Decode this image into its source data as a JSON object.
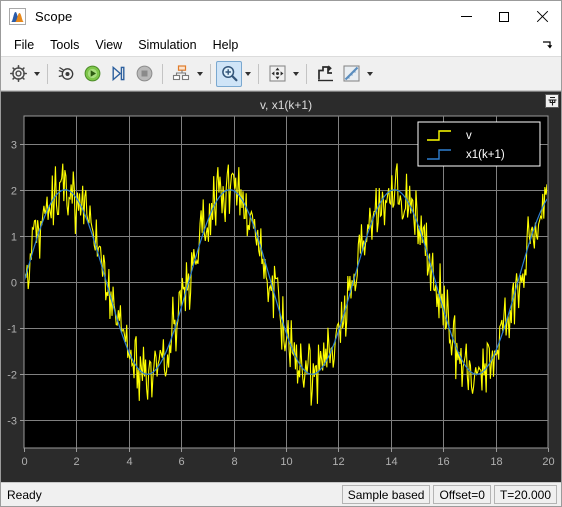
{
  "window": {
    "title": "Scope",
    "icon": "scope-app-icon",
    "controls": {
      "minimize": "minimize-icon",
      "maximize": "maximize-icon",
      "close": "close-icon"
    }
  },
  "menubar": {
    "items": [
      {
        "label": "File"
      },
      {
        "label": "Tools"
      },
      {
        "label": "View"
      },
      {
        "label": "Simulation"
      },
      {
        "label": "Help"
      }
    ],
    "expand_icon": "↘"
  },
  "toolbar": {
    "buttons": [
      {
        "name": "configuration-properties-icon",
        "tooltip": "Configuration Properties",
        "has_dropdown": true,
        "active": false
      },
      {
        "name": "simulink-link-icon",
        "tooltip": "Simulink Link",
        "has_dropdown": false,
        "active": false
      },
      {
        "name": "run-icon",
        "tooltip": "Run",
        "has_dropdown": false,
        "active": false
      },
      {
        "name": "step-forward-icon",
        "tooltip": "Step Forward",
        "has_dropdown": false,
        "active": false
      },
      {
        "name": "stop-icon",
        "tooltip": "Stop",
        "has_dropdown": false,
        "active": false
      },
      {
        "name": "layout-icon",
        "tooltip": "Layout",
        "has_dropdown": true,
        "active": false
      },
      {
        "name": "zoom-in-icon",
        "tooltip": "Zoom In",
        "has_dropdown": true,
        "active": true
      },
      {
        "name": "pan-icon",
        "tooltip": "Pan",
        "has_dropdown": true,
        "active": false
      },
      {
        "name": "autoscale-icon",
        "tooltip": "Scale Axes Limits",
        "has_dropdown": false,
        "active": false
      },
      {
        "name": "cursor-measurements-icon",
        "tooltip": "Cursor Measurements",
        "has_dropdown": true,
        "active": false
      }
    ]
  },
  "plot": {
    "title": "v, x1(k+1)",
    "pin_icon": "pin-icon",
    "background": "#000000",
    "panel_background": "#2b2b2b",
    "grid_color": "#808080",
    "axis_text_color": "#b0b0b0",
    "title_color": "#dcdcdc"
  },
  "chart_data": {
    "type": "line",
    "title": "v, x1(k+1)",
    "xlabel": "",
    "ylabel": "",
    "xlim": [
      0,
      20
    ],
    "ylim": [
      -3.6,
      3.6
    ],
    "xticks": [
      0,
      2,
      4,
      6,
      8,
      10,
      12,
      14,
      16,
      18,
      20
    ],
    "yticks": [
      3,
      2,
      1,
      0,
      -1,
      -2,
      -3
    ],
    "grid": true,
    "legend_position": "top-right",
    "series": [
      {
        "name": "v",
        "color": "#ffff00",
        "description": "Noisy measured signal: 2*sin(t) plus band-limited white noise (noise amplitude approx +/-0.45)",
        "amplitude": 2.0,
        "period": 6.283,
        "noise_amplitude": 0.45,
        "samples_per_unit": 25
      },
      {
        "name": "x1(k+1)",
        "color": "#2f7fd0",
        "description": "Kalman-filter state estimate: clean 2*sin(t)",
        "amplitude": 2.0,
        "period": 6.283,
        "noise_amplitude": 0.0,
        "samples_per_unit": 25
      }
    ]
  },
  "statusbar": {
    "ready": "Ready",
    "cells": [
      {
        "label": "Sample based"
      },
      {
        "label": "Offset=0"
      },
      {
        "label": "T=20.000"
      }
    ]
  }
}
